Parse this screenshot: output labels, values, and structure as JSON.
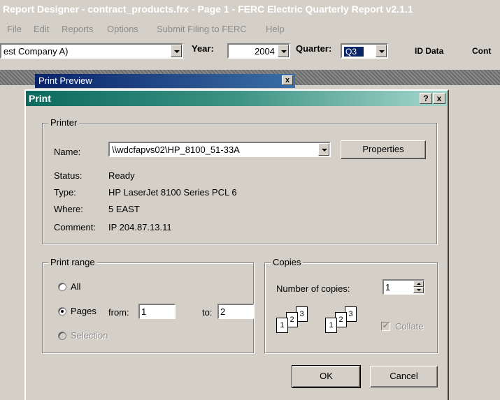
{
  "main_window": {
    "title": "Report Designer - contract_products.frx - Page 1 - FERC Electric Quarterly Report v2.1.1"
  },
  "menu": {
    "items": [
      "File",
      "Edit",
      "Reports",
      "Options",
      "Submit Filing to FERC",
      "Help"
    ]
  },
  "toolbar": {
    "company_value": "est Company A)",
    "year_label": "Year:",
    "year_value": "2004",
    "quarter_label": "Quarter:",
    "quarter_value": "Q3",
    "id_data_label": "ID Data",
    "cont_label": "Cont"
  },
  "print_preview": {
    "title": "Print Preview",
    "close_glyph": "x"
  },
  "print_dialog": {
    "title": "Print",
    "help_glyph": "?",
    "close_glyph": "x",
    "printer": {
      "group_label": "Printer",
      "name_label": "Name:",
      "name_value": "\\\\wdcfapvs02\\HP_8100_51-33A",
      "properties_button": "Properties",
      "status_label": "Status:",
      "status_value": "Ready",
      "type_label": "Type:",
      "type_value": "HP LaserJet 8100 Series PCL 6",
      "where_label": "Where:",
      "where_value": "5 EAST",
      "comment_label": "Comment:",
      "comment_value": "IP 204.87.13.11"
    },
    "print_range": {
      "group_label": "Print range",
      "all_label": "All",
      "pages_label": "Pages",
      "from_label": "from:",
      "from_value": "1",
      "to_label": "to:",
      "to_value": "2",
      "selection_label": "Selection",
      "selected": "pages"
    },
    "copies": {
      "group_label": "Copies",
      "number_label": "Number of copies:",
      "number_value": "1",
      "collate_label": "Collate",
      "collate_checked": true,
      "page_numbers": [
        "1",
        "2",
        "3"
      ]
    },
    "ok_button": "OK",
    "cancel_button": "Cancel"
  }
}
